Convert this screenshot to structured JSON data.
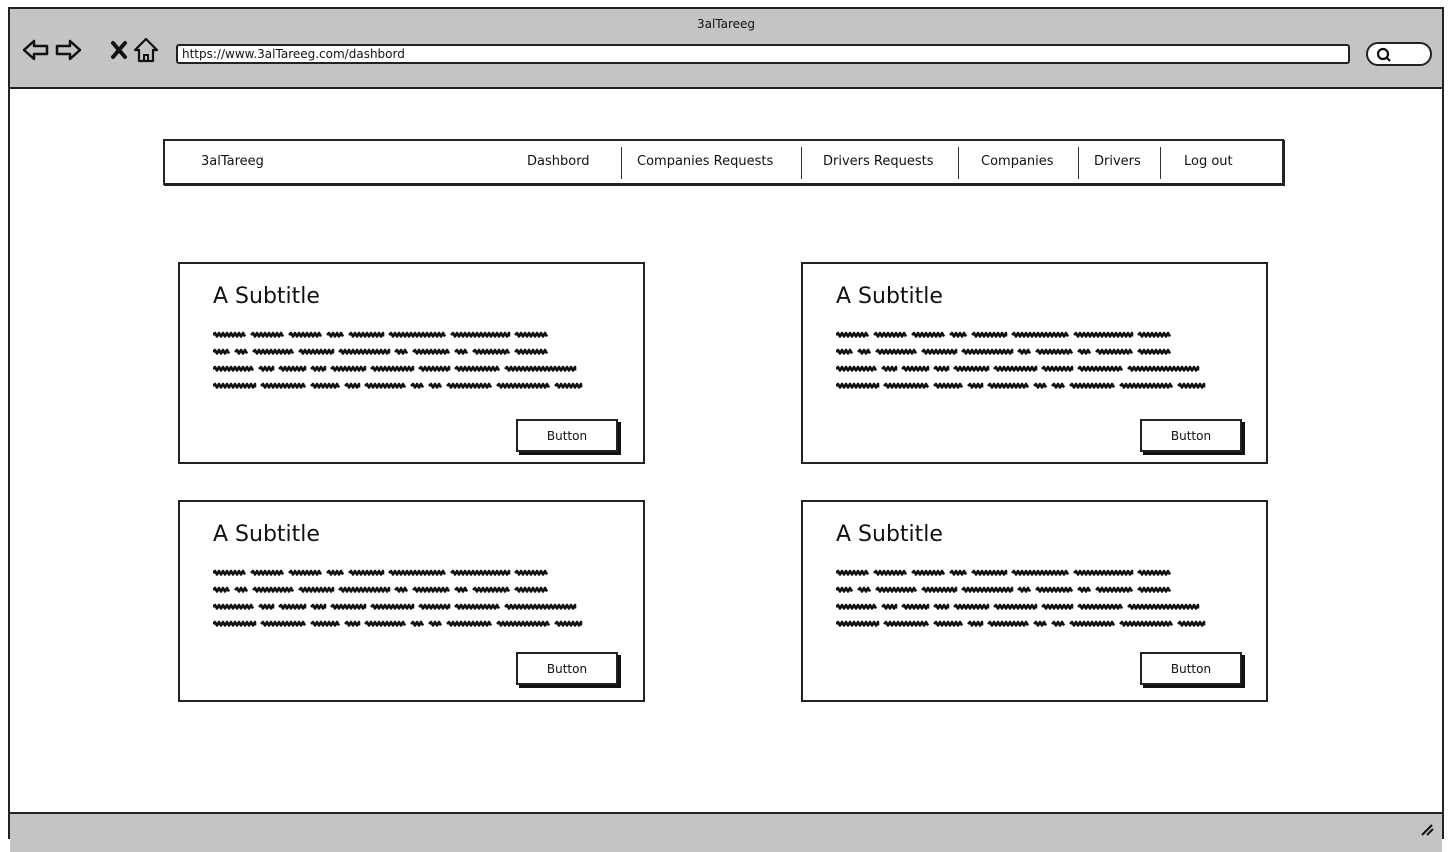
{
  "window": {
    "title": "3alTareeg",
    "url": "https://www.3alTareeg.com/dashbord"
  },
  "navbar": {
    "brand": "3alTareeg",
    "items": [
      {
        "label": "Dashbord"
      },
      {
        "label": "Companies Requests"
      },
      {
        "label": "Drivers Requests"
      },
      {
        "label": "Companies"
      },
      {
        "label": "Drivers"
      },
      {
        "label": "Log out"
      }
    ]
  },
  "cards": [
    {
      "title": "A Subtitle",
      "button": "Button"
    },
    {
      "title": "A Subtitle",
      "button": "Button"
    },
    {
      "title": "A Subtitle",
      "button": "Button"
    },
    {
      "title": "A Subtitle",
      "button": "Button"
    }
  ],
  "icons": {
    "back": "arrow-left-icon",
    "forward": "arrow-right-icon",
    "stop": "close-icon",
    "home": "home-icon",
    "search": "search-icon",
    "resize": "resize-grip-icon"
  }
}
